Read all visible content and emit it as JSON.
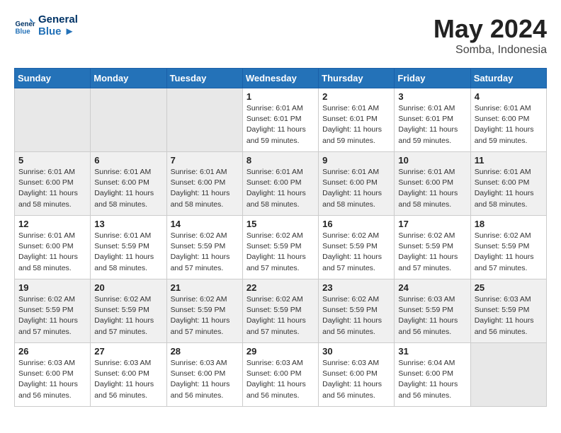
{
  "header": {
    "logo_text_general": "General",
    "logo_text_blue": "Blue",
    "month": "May 2024",
    "location": "Somba, Indonesia"
  },
  "weekdays": [
    "Sunday",
    "Monday",
    "Tuesday",
    "Wednesday",
    "Thursday",
    "Friday",
    "Saturday"
  ],
  "weeks": [
    [
      {
        "day": "",
        "info": ""
      },
      {
        "day": "",
        "info": ""
      },
      {
        "day": "",
        "info": ""
      },
      {
        "day": "1",
        "info": "Sunrise: 6:01 AM\nSunset: 6:01 PM\nDaylight: 11 hours\nand 59 minutes."
      },
      {
        "day": "2",
        "info": "Sunrise: 6:01 AM\nSunset: 6:01 PM\nDaylight: 11 hours\nand 59 minutes."
      },
      {
        "day": "3",
        "info": "Sunrise: 6:01 AM\nSunset: 6:01 PM\nDaylight: 11 hours\nand 59 minutes."
      },
      {
        "day": "4",
        "info": "Sunrise: 6:01 AM\nSunset: 6:00 PM\nDaylight: 11 hours\nand 59 minutes."
      }
    ],
    [
      {
        "day": "5",
        "info": "Sunrise: 6:01 AM\nSunset: 6:00 PM\nDaylight: 11 hours\nand 58 minutes."
      },
      {
        "day": "6",
        "info": "Sunrise: 6:01 AM\nSunset: 6:00 PM\nDaylight: 11 hours\nand 58 minutes."
      },
      {
        "day": "7",
        "info": "Sunrise: 6:01 AM\nSunset: 6:00 PM\nDaylight: 11 hours\nand 58 minutes."
      },
      {
        "day": "8",
        "info": "Sunrise: 6:01 AM\nSunset: 6:00 PM\nDaylight: 11 hours\nand 58 minutes."
      },
      {
        "day": "9",
        "info": "Sunrise: 6:01 AM\nSunset: 6:00 PM\nDaylight: 11 hours\nand 58 minutes."
      },
      {
        "day": "10",
        "info": "Sunrise: 6:01 AM\nSunset: 6:00 PM\nDaylight: 11 hours\nand 58 minutes."
      },
      {
        "day": "11",
        "info": "Sunrise: 6:01 AM\nSunset: 6:00 PM\nDaylight: 11 hours\nand 58 minutes."
      }
    ],
    [
      {
        "day": "12",
        "info": "Sunrise: 6:01 AM\nSunset: 6:00 PM\nDaylight: 11 hours\nand 58 minutes."
      },
      {
        "day": "13",
        "info": "Sunrise: 6:01 AM\nSunset: 5:59 PM\nDaylight: 11 hours\nand 58 minutes."
      },
      {
        "day": "14",
        "info": "Sunrise: 6:02 AM\nSunset: 5:59 PM\nDaylight: 11 hours\nand 57 minutes."
      },
      {
        "day": "15",
        "info": "Sunrise: 6:02 AM\nSunset: 5:59 PM\nDaylight: 11 hours\nand 57 minutes."
      },
      {
        "day": "16",
        "info": "Sunrise: 6:02 AM\nSunset: 5:59 PM\nDaylight: 11 hours\nand 57 minutes."
      },
      {
        "day": "17",
        "info": "Sunrise: 6:02 AM\nSunset: 5:59 PM\nDaylight: 11 hours\nand 57 minutes."
      },
      {
        "day": "18",
        "info": "Sunrise: 6:02 AM\nSunset: 5:59 PM\nDaylight: 11 hours\nand 57 minutes."
      }
    ],
    [
      {
        "day": "19",
        "info": "Sunrise: 6:02 AM\nSunset: 5:59 PM\nDaylight: 11 hours\nand 57 minutes."
      },
      {
        "day": "20",
        "info": "Sunrise: 6:02 AM\nSunset: 5:59 PM\nDaylight: 11 hours\nand 57 minutes."
      },
      {
        "day": "21",
        "info": "Sunrise: 6:02 AM\nSunset: 5:59 PM\nDaylight: 11 hours\nand 57 minutes."
      },
      {
        "day": "22",
        "info": "Sunrise: 6:02 AM\nSunset: 5:59 PM\nDaylight: 11 hours\nand 57 minutes."
      },
      {
        "day": "23",
        "info": "Sunrise: 6:02 AM\nSunset: 5:59 PM\nDaylight: 11 hours\nand 56 minutes."
      },
      {
        "day": "24",
        "info": "Sunrise: 6:03 AM\nSunset: 5:59 PM\nDaylight: 11 hours\nand 56 minutes."
      },
      {
        "day": "25",
        "info": "Sunrise: 6:03 AM\nSunset: 5:59 PM\nDaylight: 11 hours\nand 56 minutes."
      }
    ],
    [
      {
        "day": "26",
        "info": "Sunrise: 6:03 AM\nSunset: 6:00 PM\nDaylight: 11 hours\nand 56 minutes."
      },
      {
        "day": "27",
        "info": "Sunrise: 6:03 AM\nSunset: 6:00 PM\nDaylight: 11 hours\nand 56 minutes."
      },
      {
        "day": "28",
        "info": "Sunrise: 6:03 AM\nSunset: 6:00 PM\nDaylight: 11 hours\nand 56 minutes."
      },
      {
        "day": "29",
        "info": "Sunrise: 6:03 AM\nSunset: 6:00 PM\nDaylight: 11 hours\nand 56 minutes."
      },
      {
        "day": "30",
        "info": "Sunrise: 6:03 AM\nSunset: 6:00 PM\nDaylight: 11 hours\nand 56 minutes."
      },
      {
        "day": "31",
        "info": "Sunrise: 6:04 AM\nSunset: 6:00 PM\nDaylight: 11 hours\nand 56 minutes."
      },
      {
        "day": "",
        "info": ""
      }
    ]
  ]
}
